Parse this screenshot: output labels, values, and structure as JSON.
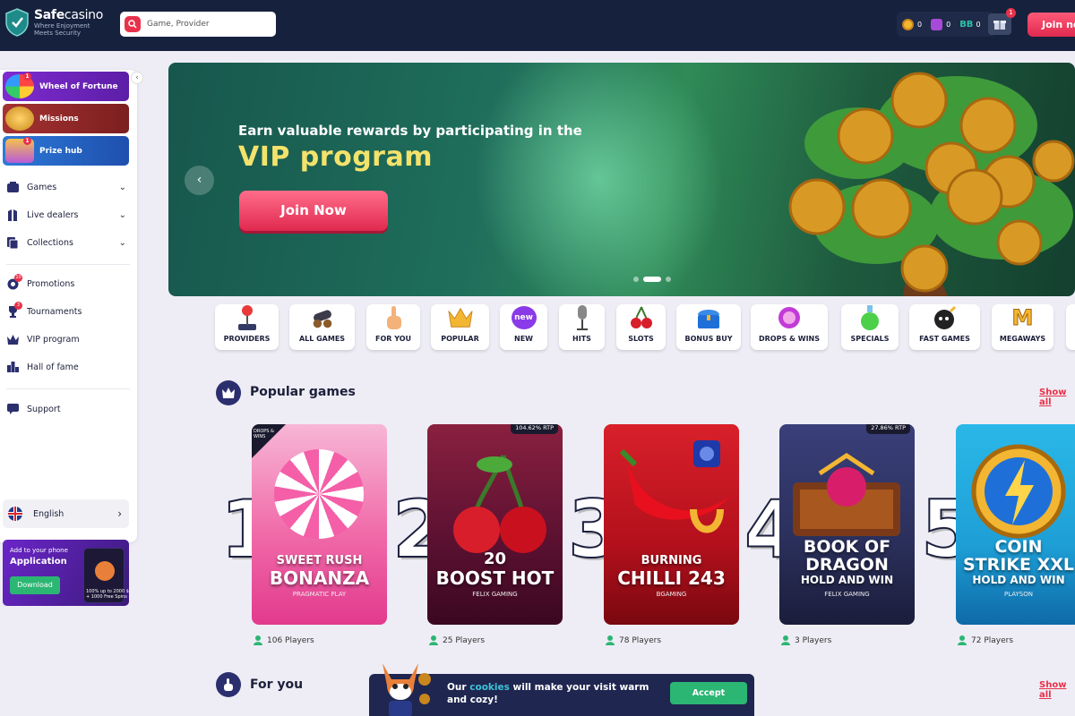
{
  "header": {
    "logo_name_bold": "Safe",
    "logo_name_rest": "casino",
    "logo_tagline_1": "Where Enjoyment",
    "logo_tagline_2": "Meets Security",
    "search_placeholder": "Game, Provider",
    "balances": [
      {
        "icon": "gold-coin-icon",
        "value": "0",
        "color": "#f2b632"
      },
      {
        "icon": "purple-gem-icon",
        "value": "0",
        "color": "#a74ad8"
      },
      {
        "icon": "bonus-points-icon",
        "label": "BB",
        "value": "0",
        "color": "#2bc4a5"
      }
    ],
    "gift_badge": "1",
    "join_label": "Join now"
  },
  "sidebar": {
    "promos": [
      {
        "label": "Wheel of Fortune",
        "badge": "1",
        "color": "#6a24b8"
      },
      {
        "label": "Missions",
        "badge": "",
        "color": "#9b2a2a"
      },
      {
        "label": "Prize hub",
        "badge": "1",
        "color": "#2a6fcf"
      }
    ],
    "nav": [
      {
        "label": "Games",
        "icon": "games-icon"
      },
      {
        "label": "Live dealers",
        "icon": "live-dealers-icon"
      },
      {
        "label": "Collections",
        "icon": "collections-icon"
      },
      {
        "label": "Promotions",
        "icon": "promotions-icon",
        "badge": "10"
      },
      {
        "label": "Tournaments",
        "icon": "trophy-icon"
      },
      {
        "label": "VIP program",
        "icon": "crown-icon"
      },
      {
        "label": "Hall of fame",
        "icon": "podium-icon"
      },
      {
        "label": "Support",
        "icon": "support-icon"
      }
    ],
    "tournaments_badge": "3",
    "language": "English",
    "app": {
      "title_small": "Add to your phone",
      "title": "Application",
      "button": "Download",
      "phone_text_1": "100% up to 2000 $",
      "phone_text_2": "+ 1000 Free Spins"
    }
  },
  "banner": {
    "line1": "Earn valuable rewards by participating in the",
    "line2": "VIP program",
    "button": "Join Now",
    "slides": 3,
    "active_slide": 2
  },
  "categories": [
    {
      "label": "PROVIDERS",
      "icon": "joystick-icon"
    },
    {
      "label": "ALL GAMES",
      "icon": "cannon-icon"
    },
    {
      "label": "FOR YOU",
      "icon": "pointing-hand-icon"
    },
    {
      "label": "POPULAR",
      "icon": "crown-icon"
    },
    {
      "label": "NEW",
      "icon": "new-badge-icon",
      "badge_text": "new"
    },
    {
      "label": "HITS",
      "icon": "microphone-icon"
    },
    {
      "label": "SLOTS",
      "icon": "cherries-icon"
    },
    {
      "label": "BONUS BUY",
      "icon": "treasure-chest-icon"
    },
    {
      "label": "DROPS & WINS",
      "icon": "drops-wins-icon"
    },
    {
      "label": "SPECIALS",
      "icon": "potion-icon"
    },
    {
      "label": "FAST GAMES",
      "icon": "bomb-icon"
    },
    {
      "label": "MEGAWAYS",
      "icon": "megaways-icon",
      "badge_text": "M"
    }
  ],
  "popular": {
    "title": "Popular games",
    "show_all": "Show all",
    "games": [
      {
        "rank": "1",
        "title1": "SWEET RUSH",
        "title2": "BONANZA",
        "provider": "PRAGMATIC PLAY",
        "players": "106 Players",
        "rtp": "",
        "badge": "DROPS & WINS",
        "bg": "#f06aa8"
      },
      {
        "rank": "2",
        "title1": "20",
        "title2": "BOOST HOT",
        "provider": "FELIX GAMING",
        "players": "25 Players",
        "rtp": "104.62% RTP",
        "bg": "#5a1030"
      },
      {
        "rank": "3",
        "title1": "BURNING",
        "title2": "CHILLI 243",
        "provider": "BGAMING",
        "players": "78 Players",
        "rtp": "",
        "bg": "#b3101c"
      },
      {
        "rank": "4",
        "title1": "BOOK OF",
        "title2": "DRAGON",
        "title3": "HOLD AND WIN",
        "provider": "FELIX GAMING",
        "players": "3 Players",
        "rtp": "27.86% RTP",
        "bg": "#2a2f5a"
      },
      {
        "rank": "5",
        "title1": "COIN",
        "title2": "STRIKE XXL",
        "title3": "HOLD AND WIN",
        "provider": "PLAYSON",
        "players": "72 Players",
        "rtp": "",
        "bg": "#1e9fd6"
      }
    ]
  },
  "for_you": {
    "title": "For you",
    "show_all": "Show all"
  },
  "cookie": {
    "text_before": "Our ",
    "link": "cookies",
    "text_after": " will make your visit warm and cozy!",
    "button": "Accept"
  }
}
